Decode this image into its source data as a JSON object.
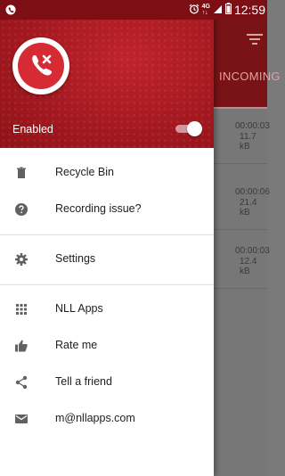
{
  "status_bar": {
    "time": "12:59",
    "network": "4G",
    "battery_level": 0.9,
    "icons": [
      "notification-icon",
      "alarm-icon",
      "network-icon",
      "signal-icon",
      "battery-icon"
    ]
  },
  "background": {
    "tab_label": "INCOMING",
    "rows": [
      {
        "duration": "00:00:03",
        "size": "11.7 kB"
      },
      {
        "duration": "00:00:06",
        "size": "21.4 kB"
      },
      {
        "duration": "00:00:03",
        "size": "12.4 kB"
      }
    ]
  },
  "drawer": {
    "enabled_label": "Enabled",
    "enabled": true,
    "groups": [
      [
        {
          "label": "Recycle Bin",
          "icon": "trash-icon"
        },
        {
          "label": "Recording issue?",
          "icon": "help-icon"
        }
      ],
      [
        {
          "label": "Settings",
          "icon": "gear-icon"
        }
      ],
      [
        {
          "label": "NLL Apps",
          "icon": "apps-grid-icon"
        },
        {
          "label": "Rate me",
          "icon": "thumbs-up-icon"
        },
        {
          "label": "Tell a friend",
          "icon": "share-icon"
        },
        {
          "label": "m@nllapps.com",
          "icon": "email-icon"
        }
      ]
    ]
  },
  "colors": {
    "primary": "#a51920",
    "accent": "#d62b35",
    "status_bar": "#7d0f14"
  }
}
